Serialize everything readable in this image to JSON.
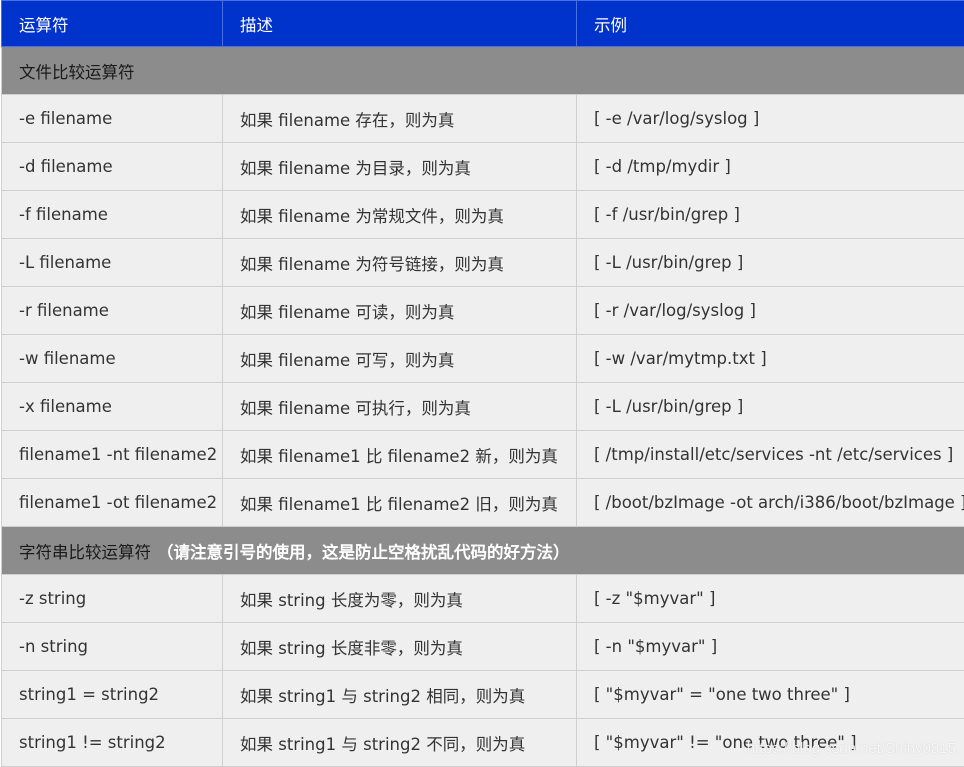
{
  "header": {
    "col1": "运算符",
    "col2": "描述",
    "col3": "示例"
  },
  "sections": [
    {
      "title": "文件比较运算符",
      "note": "",
      "rows": [
        {
          "op": "-e filename",
          "desc": "如果 filename 存在，则为真",
          "example": "[ -e /var/log/syslog ]"
        },
        {
          "op": "-d filename",
          "desc": "如果 filename 为目录，则为真",
          "example": "[ -d /tmp/mydir ]"
        },
        {
          "op": "-f filename",
          "desc": "如果 filename 为常规文件，则为真",
          "example": "[ -f /usr/bin/grep ]"
        },
        {
          "op": "-L filename",
          "desc": "如果 filename 为符号链接，则为真",
          "example": "[ -L /usr/bin/grep ]"
        },
        {
          "op": "-r filename",
          "desc": "如果 filename 可读，则为真",
          "example": "[ -r /var/log/syslog ]"
        },
        {
          "op": "-w filename",
          "desc": "如果 filename 可写，则为真",
          "example": "[ -w /var/mytmp.txt ]"
        },
        {
          "op": "-x filename",
          "desc": "如果 filename 可执行，则为真",
          "example": "[ -L /usr/bin/grep ]"
        },
        {
          "op": "filename1 -nt filename2",
          "desc": "如果 filename1 比 filename2 新，则为真",
          "example": "[ /tmp/install/etc/services -nt /etc/services ]"
        },
        {
          "op": "filename1 -ot filename2",
          "desc": "如果 filename1 比 filename2 旧，则为真",
          "example": "[ /boot/bzImage -ot arch/i386/boot/bzImage ]"
        }
      ]
    },
    {
      "title": "字符串比较运算符",
      "note": "（请注意引号的使用，这是防止空格扰乱代码的好方法）",
      "rows": [
        {
          "op": "-z string",
          "desc": "如果 string 长度为零，则为真",
          "example": "[ -z \"$myvar\" ]"
        },
        {
          "op": "-n string",
          "desc": "如果 string 长度非零，则为真",
          "example": "[ -n \"$myvar\" ]"
        },
        {
          "op": "string1 = string2",
          "desc": "如果 string1 与 string2 相同，则为真",
          "example": "[ \"$myvar\" = \"one two three\" ]"
        },
        {
          "op": "string1 != string2",
          "desc": "如果 string1 与 string2 不同，则为真",
          "example": "[ \"$myvar\" != \"one two three\" ]"
        }
      ]
    }
  ],
  "watermark": "https://blog.csdn.net/Shiny0815"
}
